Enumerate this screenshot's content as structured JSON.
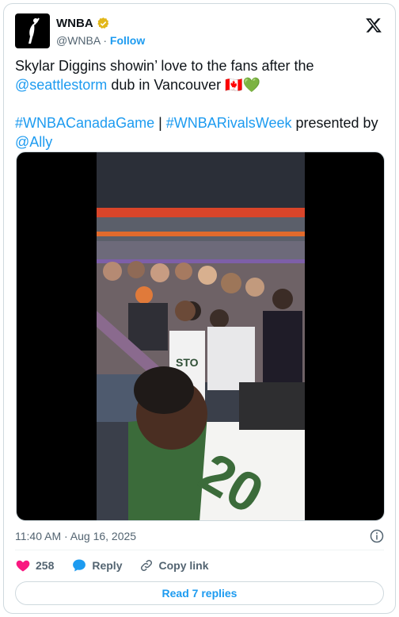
{
  "account": {
    "display_name": "WNBA",
    "handle": "@WNBA",
    "separator": "·",
    "follow_label": "Follow",
    "verified_color": "#e2b719"
  },
  "tweet": {
    "text_part1": "Skylar Diggins showin’ love to the fans after the ",
    "mention_1": "@seattlestorm",
    "text_part2": " dub in Vancouver 🇨🇦💚",
    "hashtag_1": "#WNBACanadaGame",
    "pipe": " | ",
    "hashtag_2": "#WNBARivalsWeek",
    "text_part3": " presented by ",
    "mention_2": "@Ally"
  },
  "media": {
    "type": "video",
    "jersey_number": "20",
    "jersey_letters": "STO"
  },
  "meta": {
    "timestamp": "11:40 AM · Aug 16, 2025"
  },
  "actions": {
    "like_count": "258",
    "reply_label": "Reply",
    "copy_link_label": "Copy link"
  },
  "replies_button": {
    "label": "Read 7 replies"
  },
  "colors": {
    "accent": "#1d9bf0",
    "like": "#f91880",
    "muted": "#536471"
  }
}
